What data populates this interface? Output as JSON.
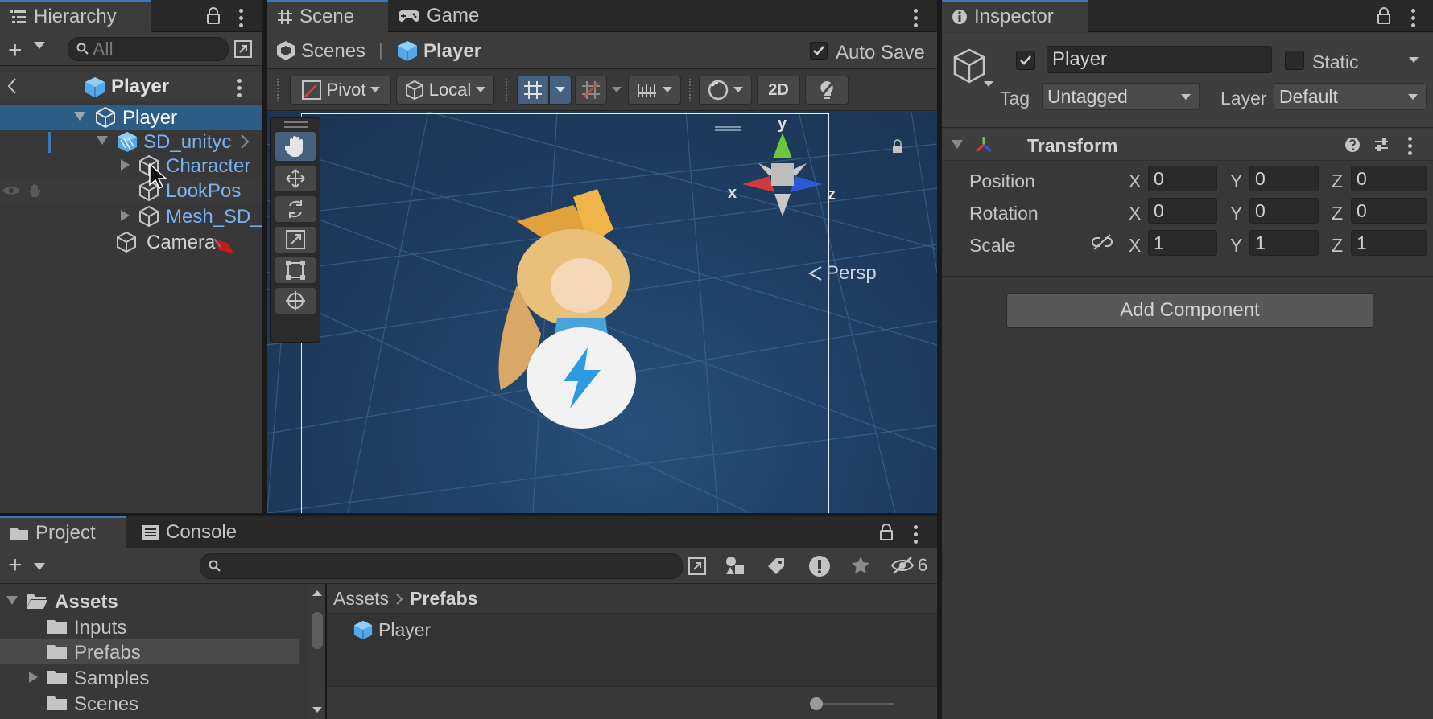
{
  "hierarchy": {
    "tab_label": "Hierarchy",
    "search_placeholder": "All",
    "prefab_header": "Player",
    "items": [
      {
        "label": "Player"
      },
      {
        "label": "SD_unityc"
      },
      {
        "label": "Character"
      },
      {
        "label": "LookPos"
      },
      {
        "label": "Mesh_SD_"
      },
      {
        "label": "Camera"
      }
    ]
  },
  "scene": {
    "tabs": [
      {
        "label": "Scene"
      },
      {
        "label": "Game"
      }
    ],
    "breadcrumb": {
      "root": "Scenes",
      "current": "Player"
    },
    "auto_save_label": "Auto Save",
    "auto_save_checked": true,
    "pivot_label": "Pivot",
    "local_label": "Local",
    "mode_2d_label": "2D",
    "gizmo": {
      "y": "y",
      "x": "x",
      "z": "z"
    },
    "persp_label": "Persp"
  },
  "inspector": {
    "tab_label": "Inspector",
    "object_name": "Player",
    "active_checked": true,
    "static_label": "Static",
    "tag_label": "Tag",
    "tag_value": "Untagged",
    "layer_label": "Layer",
    "layer_value": "Default",
    "transform": {
      "title": "Transform",
      "position": {
        "label": "Position",
        "x": "0",
        "y": "0",
        "z": "0"
      },
      "rotation": {
        "label": "Rotation",
        "x": "0",
        "y": "0",
        "z": "0"
      },
      "scale": {
        "label": "Scale",
        "x": "1",
        "y": "1",
        "z": "1"
      },
      "axis_x": "X",
      "axis_y": "Y",
      "axis_z": "Z"
    },
    "add_component_label": "Add Component"
  },
  "project": {
    "tabs": [
      {
        "label": "Project"
      },
      {
        "label": "Console"
      }
    ],
    "hidden_count": "6",
    "tree": [
      {
        "label": "Assets"
      },
      {
        "label": "Inputs"
      },
      {
        "label": "Prefabs"
      },
      {
        "label": "Samples"
      },
      {
        "label": "Scenes"
      }
    ],
    "breadcrumb": {
      "root": "Assets",
      "current": "Prefabs"
    },
    "files": [
      {
        "label": "Player"
      }
    ]
  },
  "colors": {
    "accent": "#3a79bb",
    "selected_row": "#2c5d87",
    "prefab_blue": "#7bb1f5",
    "scene_bg": "#1e3a5c"
  }
}
